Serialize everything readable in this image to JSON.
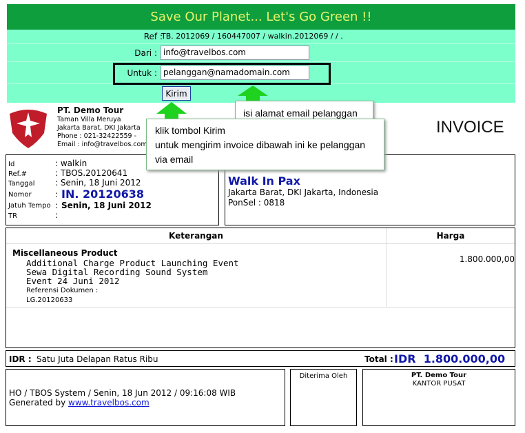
{
  "banner": {
    "text": "Save Our Planet... Let's Go Green !!"
  },
  "email_form": {
    "ref_label": "Ref :",
    "ref_value": "TB. 2012069 / 160447007 / walkin.2012069 / / .",
    "from_label": "Dari :",
    "from_value": "info@travelbos.com",
    "to_label": "Untuk :",
    "to_value": "pelanggan@namadomain.com",
    "send_label": "Kirim"
  },
  "callouts": {
    "email_hint": "isi alamat email pelanggan",
    "send_hint_1": "klik tombol Kirim",
    "send_hint_2": "untuk mengirim invoice dibawah ini ke pelanggan",
    "send_hint_3": "via email"
  },
  "company": {
    "name": "PT. Demo Tour",
    "address_1": "Taman Villa Meruya",
    "address_2": "Jakarta Barat, DKI Jakarta",
    "phone": "Phone : 021-32422559 -",
    "email": "Email : info@travelbos.com"
  },
  "invoice_title": "INVOICE",
  "details": {
    "id_label": "Id",
    "id_value": ": walkin",
    "ref_label": "Ref.#",
    "ref_value": ": TBOS.20120641",
    "date_label": "Tanggal",
    "date_value": ": Senin, 18 Juni 2012",
    "number_label": "Nomor",
    "number_colon": ":",
    "number_value": "IN. 20120638",
    "due_label": "Jatuh Tempo",
    "due_colon": ":",
    "due_value": "Senin, 18 Juni 2012",
    "tr_label": "TR",
    "tr_value": ":"
  },
  "customer": {
    "name": "Walk In Pax",
    "address": "Jakarta Barat, DKI Jakarta, Indonesia",
    "phone": "PonSel : 0818"
  },
  "items_table": {
    "col_desc": "Keterangan",
    "col_price": "Harga",
    "product": "Miscellaneous Product",
    "line_1": "Additional Charge Product Launching Event",
    "line_2": "Sewa Digital Recording Sound System",
    "line_3": "Event 24 Juni 2012",
    "ref_doc_label": "Referensi Dokumen :",
    "ref_doc_value": "LG.20120633",
    "price": "1.800.000,00"
  },
  "totals": {
    "words_label": "IDR :",
    "words_value": "Satu Juta Delapan Ratus Ribu",
    "total_label": "Total :",
    "total_value": "IDR  1.800.000,00"
  },
  "footer": {
    "system_line": "HO / TBOS System / Senin, 18 Jun 2012 / 09:16:08 WIB",
    "generated_by": "Generated by ",
    "generated_link": "www.travelbos.com",
    "received_label": "Diterima Oleh",
    "company_name": "PT. Demo Tour",
    "office": "KANTOR PUSAT"
  },
  "colors": {
    "banner_bg": "#0f9e3e",
    "banner_text": "#e6f56a",
    "form_bg": "#7dffcc",
    "arrow": "#1ed21e",
    "accent_blue": "#1018a8"
  }
}
